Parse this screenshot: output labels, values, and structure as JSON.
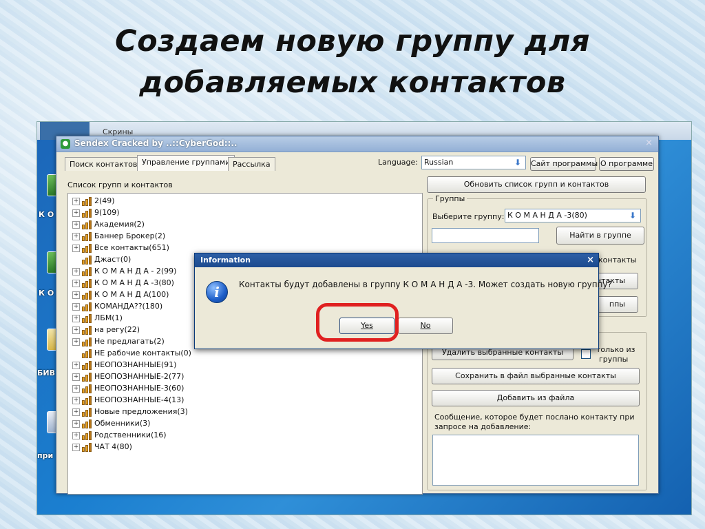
{
  "slide": {
    "title_line1": "Создаем новую группу для",
    "title_line2": "добавляемых контактов"
  },
  "desktop": {
    "top_label": "Скрины",
    "icon_labels": [
      "К О",
      "К О",
      "БИВ",
      "при"
    ]
  },
  "window": {
    "title": "Sendex Cracked by ..::CyberGod::..",
    "close_glyph": "×"
  },
  "tabs": [
    {
      "label": "Поиск контактов",
      "active": false
    },
    {
      "label": "Управление группами",
      "active": true
    },
    {
      "label": "Рассылка",
      "active": false
    }
  ],
  "toolbar": {
    "language_label": "Language:",
    "language_value": "Russian",
    "site_button": "Сайт программы",
    "about_button": "О программе"
  },
  "left_panel": {
    "label": "Список групп и контактов",
    "items": [
      {
        "text": "2(49)",
        "expandable": true
      },
      {
        "text": "9(109)",
        "expandable": true
      },
      {
        "text": "Академия(2)",
        "expandable": true
      },
      {
        "text": "Баннер Брокер(2)",
        "expandable": true
      },
      {
        "text": "Все контакты(651)",
        "expandable": true
      },
      {
        "text": "Джаст(0)",
        "expandable": false
      },
      {
        "text": "К О М А Н Д А - 2(99)",
        "expandable": true
      },
      {
        "text": "К О М А Н Д А -3(80)",
        "expandable": true
      },
      {
        "text": "К О М А Н Д А(100)",
        "expandable": true
      },
      {
        "text": "КОМАНДА??(180)",
        "expandable": true
      },
      {
        "text": "ЛБМ(1)",
        "expandable": true
      },
      {
        "text": "на регу(22)",
        "expandable": true
      },
      {
        "text": "Не предлагать(2)",
        "expandable": true
      },
      {
        "text": "НЕ рабочие контакты(0)",
        "expandable": false
      },
      {
        "text": "НЕОПОЗНАННЫЕ(91)",
        "expandable": true
      },
      {
        "text": "НЕОПОЗНАННЫЕ-2(77)",
        "expandable": true
      },
      {
        "text": "НЕОПОЗНАННЫЕ-3(60)",
        "expandable": true
      },
      {
        "text": "НЕОПОЗНАННЫЕ-4(13)",
        "expandable": true
      },
      {
        "text": "Новые предложения(3)",
        "expandable": true
      },
      {
        "text": "Обменники(3)",
        "expandable": true
      },
      {
        "text": "Родственники(16)",
        "expandable": true
      },
      {
        "text": "ЧАТ 4(80)",
        "expandable": true
      }
    ]
  },
  "right_panel": {
    "refresh_button": "Обновить список групп и контактов",
    "groups_title": "Группы",
    "choose_group_label": "Выберите группу:",
    "choose_group_value": "К О М А Н Д А -3(80)",
    "find_in_group_button": "Найти в группе",
    "partial_contacts": "контакты",
    "partial_button1": "нтакты",
    "partial_button2": "ппы",
    "delete_selected_button": "Удалить выбранные контакты",
    "only_from_groups_line1": "только из",
    "only_from_groups_line2": "группы",
    "save_selected_button": "Сохранить в файл выбранные контакты",
    "add_from_file_button": "Добавить из файла",
    "message_label_line1": "Сообщение, которое будет послано контакту при",
    "message_label_line2": "запросе на добавление:"
  },
  "dialog": {
    "title": "Information",
    "close_glyph": "×",
    "message": "Контакты будут добавлены в группу  К О М А Н Д А -3. Может создать новую группу?",
    "yes_button": "Yes",
    "no_button": "No",
    "highlight_color": "#e02020"
  }
}
